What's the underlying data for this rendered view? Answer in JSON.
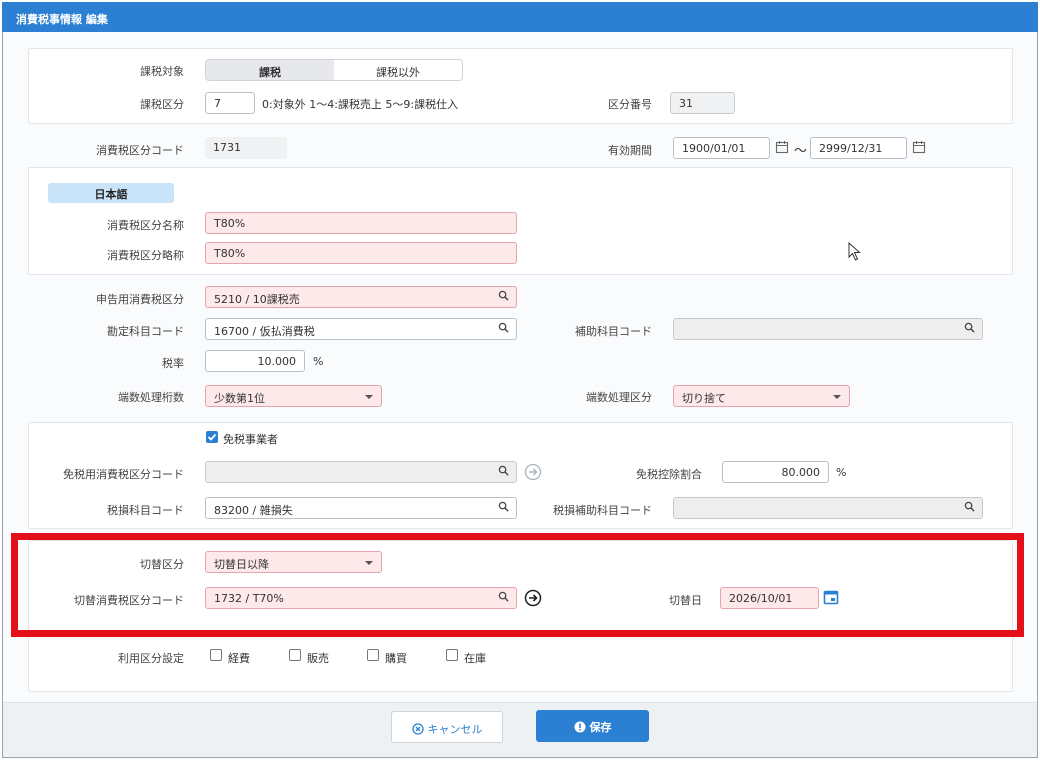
{
  "window": {
    "title": "消費税事情報 編集"
  },
  "taxable": {
    "label": "課税対象",
    "options": [
      "課税",
      "課税以外"
    ],
    "selected": "課税"
  },
  "tax_type": {
    "label": "課税区分",
    "value": "7",
    "hint": "0:対象外  1〜4:課税売上  5〜9:課税仕入"
  },
  "category_no": {
    "label": "区分番号",
    "value": "31"
  },
  "tax_code": {
    "label": "消費税区分コード",
    "value": "1731"
  },
  "valid_period": {
    "label": "有効期間",
    "from": "1900/01/01",
    "tilde": "〜",
    "to": "2999/12/31"
  },
  "language": {
    "tab": "日本語",
    "name_label": "消費税区分名称",
    "name_value": "T80%",
    "short_label": "消費税区分略称",
    "short_value": "T80%"
  },
  "fields": {
    "declare_label": "申告用消費税区分",
    "declare_value": "5210 / 10課税売",
    "account_label": "勘定科目コード",
    "account_value": "16700 / 仮払消費税",
    "sub_account_label": "補助科目コード",
    "sub_account_value": "",
    "rate_label": "税率",
    "rate_value": "10.000",
    "rate_unit": "%",
    "rounding_digits_label": "端数処理桁数",
    "rounding_digits_value": "少数第1位",
    "rounding_type_label": "端数処理区分",
    "rounding_type_value": "切り捨て"
  },
  "exempt": {
    "checkbox_label": "免税事業者",
    "checked": true,
    "code_label": "免税用消費税区分コード",
    "code_value": "",
    "deduct_label": "免税控除割合",
    "deduct_value": "80.000",
    "deduct_unit": "%",
    "loss_label": "税損科目コード",
    "loss_value": "83200 / 雑損失",
    "loss_sub_label": "税損補助科目コード",
    "loss_sub_value": ""
  },
  "switch": {
    "type_label": "切替区分",
    "type_value": "切替日以降",
    "code_label": "切替消費税区分コード",
    "code_value": "1732 / T70%",
    "date_label": "切替日",
    "date_value": "2026/10/01"
  },
  "usage": {
    "label": "利用区分設定",
    "items": [
      "経費",
      "販売",
      "購買",
      "在庫"
    ]
  },
  "buttons": {
    "cancel": "キャンセル",
    "save": "保存"
  },
  "colors": {
    "accent": "#2c80d3",
    "required_bg": "#fde8ea",
    "highlight": "#e3101a"
  }
}
